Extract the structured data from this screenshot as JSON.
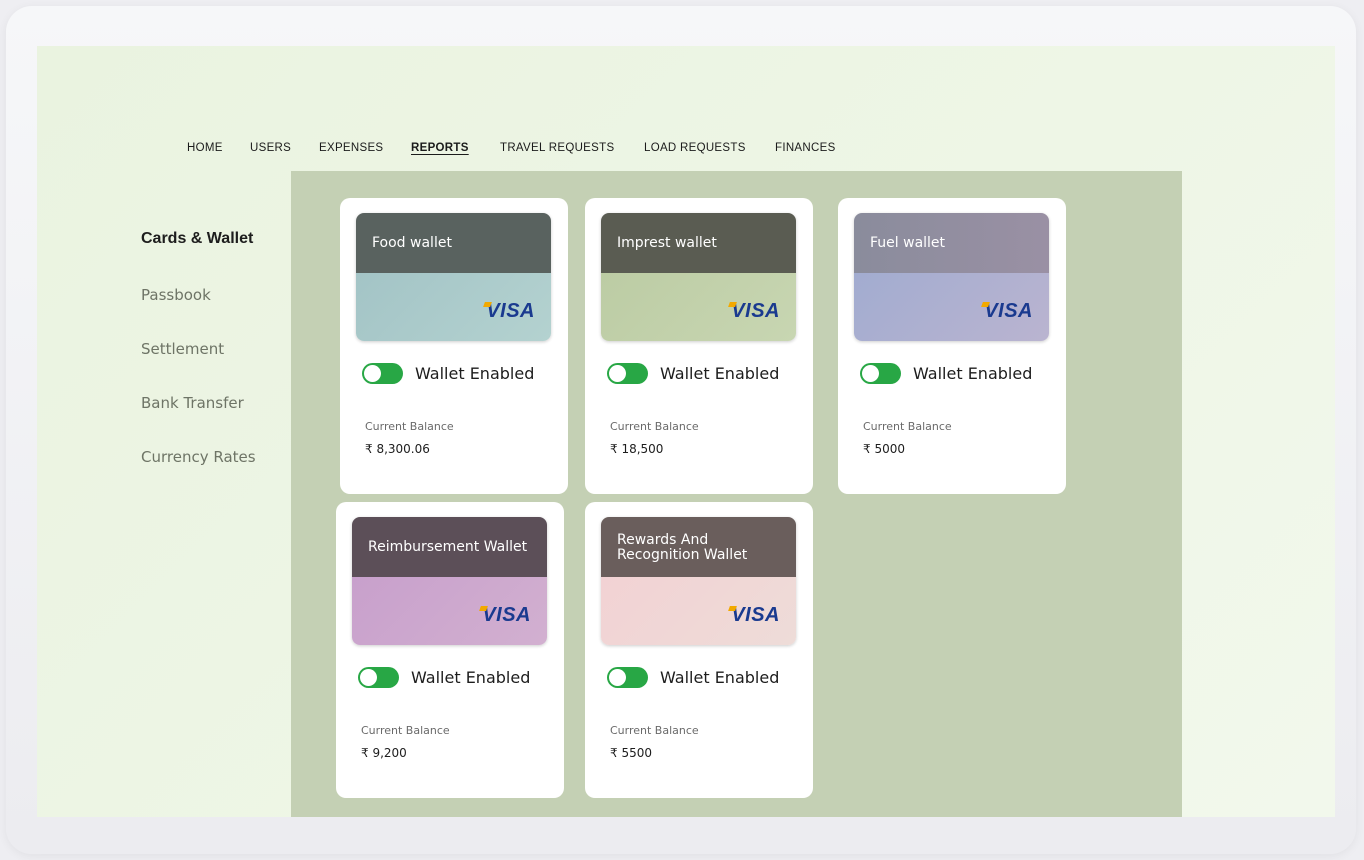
{
  "nav": {
    "items": [
      "HOME",
      "USERS",
      "EXPENSES",
      "REPORTS",
      "TRAVEL REQUESTS",
      "LOAD REQUESTS",
      "FINANCES"
    ],
    "active": "REPORTS"
  },
  "sidebar": {
    "items": [
      "Cards & Wallet",
      "Passbook",
      "Settlement",
      "Bank Transfer",
      "Currency Rates"
    ],
    "active": "Cards & Wallet"
  },
  "wallets": [
    {
      "name": "Food wallet",
      "brand": "VISA",
      "toggle_label": "Wallet Enabled",
      "enabled": true,
      "balance_label": "Current Balance",
      "balance": "₹ 8,300.06",
      "top_color": "#59625f",
      "bottom_color": "#a8c8c8"
    },
    {
      "name": "Imprest wallet",
      "brand": "VISA",
      "toggle_label": "Wallet Enabled",
      "enabled": true,
      "balance_label": "Current Balance",
      "balance": "₹ 18,500",
      "top_color": "#5a5c52",
      "bottom_color": "#c0d0a8"
    },
    {
      "name": "Fuel wallet",
      "brand": "VISA",
      "toggle_label": "Wallet Enabled",
      "enabled": true,
      "balance_label": "Current Balance",
      "balance": "₹ 5000",
      "top_color": "#8c8a9a",
      "bottom_color": "#a8b0d0"
    },
    {
      "name": "Reimbursement Wallet",
      "brand": "VISA",
      "toggle_label": "Wallet Enabled",
      "enabled": true,
      "balance_label": "Current Balance",
      "balance": "₹ 9,200",
      "top_color": "#5c4f58",
      "bottom_color": "#cca4cc"
    },
    {
      "name": "Rewards And Recognition Wallet",
      "brand": "VISA",
      "toggle_label": "Wallet Enabled",
      "enabled": true,
      "balance_label": "Current Balance",
      "balance": "₹ 5500",
      "top_color": "#6a5e5c",
      "bottom_color": "#f0d4d6"
    }
  ],
  "colors": {
    "toggle_on": "#28a745",
    "content_bg": "#c4d0b4"
  }
}
